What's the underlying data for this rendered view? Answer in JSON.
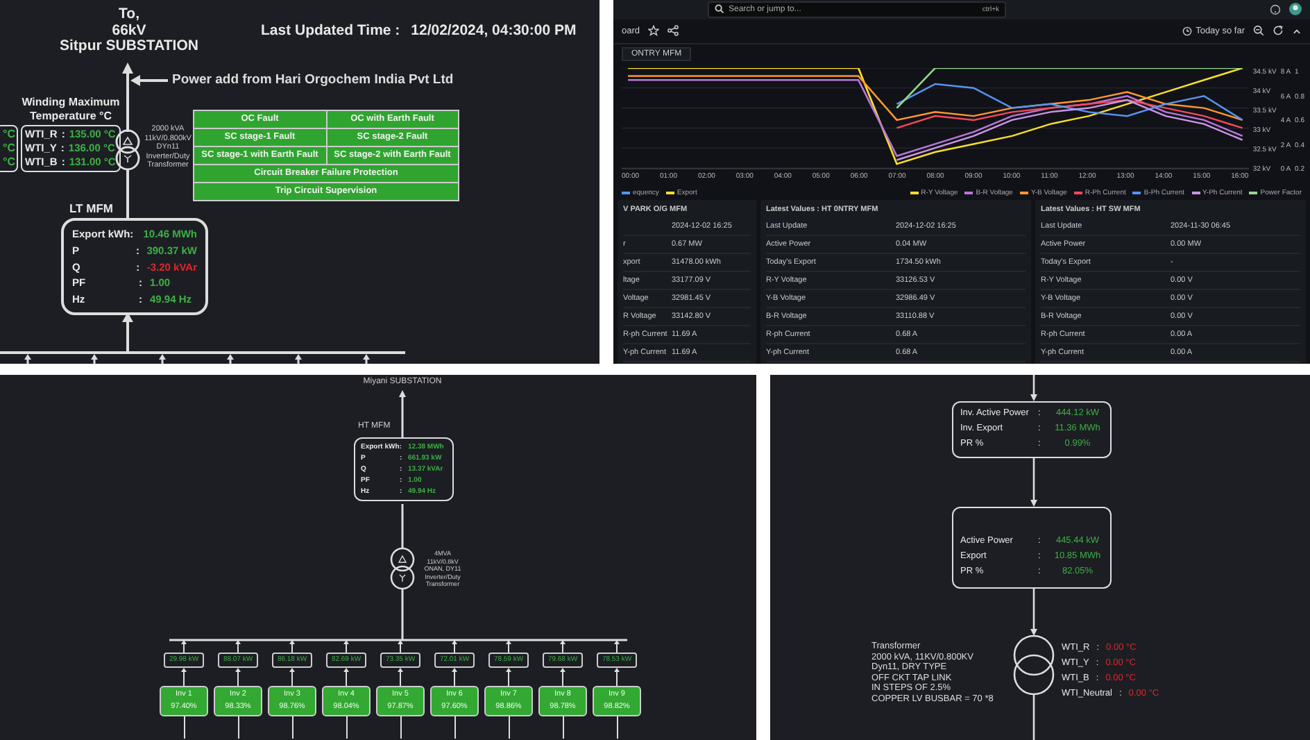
{
  "substation_view": {
    "destination": [
      "To,",
      "66kV",
      "Sitpur SUBSTATION"
    ],
    "last_updated": {
      "label": "Last Updated Time :",
      "value": "12/02/2024, 04:30:00 PM"
    },
    "power_note": "Power add from Hari Orgochem India Pvt Ltd",
    "partial_readings": [
      "°C",
      "°C",
      "°C"
    ],
    "winding_title": "Winding Maximum Temperature °C",
    "winding": [
      {
        "label": "WTI_R",
        "separator": ":",
        "value": "135.00 °C"
      },
      {
        "label": "WTI_Y",
        "separator": ":",
        "value": "136.00 °C"
      },
      {
        "label": "WTI_B",
        "separator": ":",
        "value": "131.00 °C"
      }
    ],
    "transformer_label": [
      "2000 kVA",
      "11kV/0.800kV",
      "DYn11",
      "Inverter/Duty",
      "Transformer"
    ],
    "fault_grid": [
      [
        "OC Fault",
        "OC with Earth Fault"
      ],
      [
        "SC stage-1 Fault",
        "SC stage-2 Fault"
      ],
      [
        "SC stage-1 with Earth Fault",
        "SC stage-2 with Earth Fault"
      ],
      [
        "Circuit Breaker Failure Protection"
      ],
      [
        "Trip Circuit Supervision"
      ]
    ],
    "meter": {
      "title": "LT MFM",
      "rows": [
        {
          "label": "Export kWh:",
          "value": "10.46 MWh",
          "color": "#3cb043"
        },
        {
          "label": "P",
          "separator": ":",
          "value": "390.37 kW",
          "color": "#3cb043"
        },
        {
          "label": "Q",
          "separator": ":",
          "value": "-3.20 kVAr",
          "color": "#e0262b"
        },
        {
          "label": "PF",
          "separator": ":",
          "value": "1.00",
          "color": "#3cb043"
        },
        {
          "label": "Hz",
          "separator": ":",
          "value": "49.94 Hz",
          "color": "#3cb043"
        }
      ]
    }
  },
  "dashboard": {
    "search": {
      "placeholder": "Search or jump to...",
      "shortcut": "ctrl+k"
    },
    "breadcrumb": "oard",
    "time_range": "Today so far",
    "variable": "ONTRY MFM",
    "chart": {
      "chart_data": {
        "type": "line",
        "categories": [
          "00:00",
          "01:00",
          "02:00",
          "03:00",
          "04:00",
          "05:00",
          "06:00",
          "07:00",
          "08:00",
          "09:00",
          "10:00",
          "11:00",
          "12:00",
          "13:00",
          "14:00",
          "15:00",
          "16:00"
        ],
        "ylim": [
          32,
          34.5
        ],
        "grid": true,
        "yticks": [
          {
            "value": 34.5,
            "label": "34.5 kV"
          },
          {
            "value": 34,
            "label": "34 kV"
          },
          {
            "value": 33.5,
            "label": "33.5 kV"
          },
          {
            "value": 33,
            "label": "33 kV"
          },
          {
            "value": 32.5,
            "label": "32.5 kV"
          },
          {
            "value": 32,
            "label": "32 kV"
          }
        ],
        "series": [
          {
            "name": "R-Y Voltage",
            "color": "#fade2a",
            "values": [
              34.5,
              34.5,
              34.5,
              34.5,
              34.5,
              34.5,
              34.5,
              32.1,
              32.4,
              32.6,
              32.8,
              33.1,
              33.3,
              33.6,
              33.9,
              34.2,
              34.5
            ]
          },
          {
            "name": "B-R Voltage",
            "color": "#b877d9",
            "values": [
              34.2,
              34.2,
              34.2,
              34.2,
              34.2,
              34.2,
              34.2,
              32.3,
              32.6,
              32.9,
              33.3,
              33.5,
              33.6,
              33.8,
              33.4,
              33.2,
              32.8
            ]
          },
          {
            "name": "Y-B Voltage",
            "color": "#ff9830",
            "values": [
              34.3,
              34.3,
              34.3,
              34.3,
              34.3,
              34.3,
              34.3,
              33.2,
              33.4,
              33.3,
              33.5,
              33.6,
              33.7,
              33.9,
              33.6,
              33.5,
              33.2
            ]
          },
          {
            "name": "R-Ph Current",
            "color": "#f2495c",
            "values": [
              null,
              null,
              null,
              null,
              null,
              null,
              null,
              33.0,
              33.3,
              33.2,
              33.4,
              33.5,
              33.6,
              33.7,
              33.5,
              33.3,
              33.0
            ]
          },
          {
            "name": "B-Ph Current",
            "color": "#5794f2",
            "values": [
              null,
              null,
              null,
              null,
              null,
              null,
              null,
              33.6,
              34.1,
              34.0,
              33.5,
              33.6,
              33.4,
              33.3,
              33.6,
              33.8,
              33.2
            ]
          },
          {
            "name": "Y-Ph Current",
            "color": "#ca95e5",
            "values": [
              null,
              null,
              null,
              null,
              null,
              null,
              null,
              32.2,
              32.5,
              32.8,
              33.2,
              33.4,
              33.5,
              33.7,
              33.3,
              33.1,
              32.7
            ]
          },
          {
            "name": "Power Factor",
            "color": "#96d98d",
            "values": [
              null,
              null,
              null,
              null,
              null,
              null,
              null,
              33.5,
              34.5,
              34.5,
              34.5,
              34.5,
              34.5,
              34.5,
              34.5,
              34.5,
              34.5
            ]
          }
        ]
      },
      "y_axes": [
        [
          "8 A",
          "6 A",
          "4 A",
          "2 A",
          "0 A"
        ],
        [
          "1",
          "0.8",
          "0.6",
          "0.4",
          "0.2"
        ]
      ],
      "legend_left": [
        {
          "label": "equency",
          "color": "#5794f2"
        },
        {
          "label": "Export",
          "color": "#fade2a"
        }
      ]
    },
    "tables": [
      {
        "title": "V PARK O/G MFM",
        "rows": [
          {
            "value": "2024-12-02 16:25"
          },
          {
            "label": "r",
            "value": "0.67 MW"
          },
          {
            "label": "xport",
            "value": "31478.00 kWh"
          },
          {
            "label": "ltage",
            "value": "33177.09 V"
          },
          {
            "label": "Voltage",
            "value": "32981.45 V"
          },
          {
            "label": "R Voltage",
            "value": "33142.80 V"
          },
          {
            "label": "R-ph Current",
            "value": "11.69 A"
          },
          {
            "label": "Y-ph Current",
            "value": "11.69 A"
          }
        ]
      },
      {
        "title": "Latest Values : HT 0NTRY MFM",
        "rows": [
          {
            "label": "Last Update",
            "value": "2024-12-02 16:25"
          },
          {
            "label": "Active Power",
            "value": "0.04 MW"
          },
          {
            "label": "Today's Export",
            "value": "1734.50 kWh"
          },
          {
            "label": "R-Y Voltage",
            "value": "33126.53 V"
          },
          {
            "label": "Y-B Voltage",
            "value": "32986.49 V"
          },
          {
            "label": "B-R Voltage",
            "value": "33110.88 V"
          },
          {
            "label": "R-ph Current",
            "value": "0.68 A"
          },
          {
            "label": "Y-ph Current",
            "value": "0.68 A"
          }
        ]
      },
      {
        "title": "Latest Values : HT SW MFM",
        "rows": [
          {
            "label": "Last Update",
            "value": "2024-11-30 06:45"
          },
          {
            "label": "Active Power",
            "value": "0.00 MW"
          },
          {
            "label": "Today's Export",
            "value": "-"
          },
          {
            "label": "R-Y Voltage",
            "value": "0.00 V"
          },
          {
            "label": "Y-B Voltage",
            "value": "0.00 V"
          },
          {
            "label": "B-R Voltage",
            "value": "0.00 V"
          },
          {
            "label": "R-ph Current",
            "value": "0.00 A"
          },
          {
            "label": "Y-ph Current",
            "value": "0.00 A"
          }
        ]
      }
    ]
  },
  "inverter_view": {
    "destination": "Miyani SUBSTATION",
    "meter": {
      "title": "HT MFM",
      "rows": [
        {
          "label": "Export kWh:",
          "value": "12.38 MWh"
        },
        {
          "label": "P",
          "separator": ":",
          "value": "661.93 kW"
        },
        {
          "label": "Q",
          "separator": ":",
          "value": "13.37 kVAr"
        },
        {
          "label": "PF",
          "separator": ":",
          "value": "1.00"
        },
        {
          "label": "Hz",
          "separator": ":",
          "value": "49.94 Hz"
        }
      ]
    },
    "transformer_label": [
      "4MVA",
      "11kV/0.8kV",
      "ONAN, DY11",
      "Inverter/Duty",
      "Transformer"
    ],
    "inverters": [
      {
        "power": "29.98 kW",
        "name": "Inv 1",
        "efficiency": "97.40%"
      },
      {
        "power": "88.07 kW",
        "name": "Inv 2",
        "efficiency": "98.33%"
      },
      {
        "power": "86.18 kW",
        "name": "Inv 3",
        "efficiency": "98.76%"
      },
      {
        "power": "82.69 kW",
        "name": "Inv 4",
        "efficiency": "98.04%"
      },
      {
        "power": "73.35 kW",
        "name": "Inv 5",
        "efficiency": "97.87%"
      },
      {
        "power": "72.01 kW",
        "name": "Inv 6",
        "efficiency": "97.60%"
      },
      {
        "power": "78.59 kW",
        "name": "Inv 7",
        "efficiency": "98.86%"
      },
      {
        "power": "79.68 kW",
        "name": "Inv 8",
        "efficiency": "98.78%"
      },
      {
        "power": "78.53 kW",
        "name": "Inv 9",
        "efficiency": "98.82%"
      }
    ]
  },
  "plant_view": {
    "inverter_summary": [
      {
        "label": "Inv. Active Power",
        "separator": ":",
        "value": "444.12 kW"
      },
      {
        "label": "Inv. Export",
        "separator": ":",
        "value": "11.36 MWh"
      },
      {
        "label": "PR %",
        "separator": ":",
        "value": "0.99%"
      }
    ],
    "plant_summary": [
      {
        "label": "Active Power",
        "separator": ":",
        "value": "445.44 kW"
      },
      {
        "label": "Export",
        "separator": ":",
        "value": "10.85 MWh"
      },
      {
        "label": "PR %",
        "separator": ":",
        "value": "82.05%"
      }
    ],
    "transformer_notes": [
      "Transformer",
      "2000 kVA, 11KV/0.800KV",
      "Dyn11, DRY TYPE",
      "OFF CKT TAP LINK",
      "IN STEPS OF 2.5%",
      "COPPER LV BUSBAR = 70 *8"
    ],
    "wti": [
      {
        "label": "WTI_R",
        "separator": ":",
        "value": "0.00 °C"
      },
      {
        "label": "WTI_Y",
        "separator": ":",
        "value": "0.00 °C"
      },
      {
        "label": "WTI_B",
        "separator": ":",
        "value": "0.00 °C"
      },
      {
        "label": "WTI_Neutral",
        "separator": ":",
        "value": "0.00 °C"
      }
    ]
  }
}
